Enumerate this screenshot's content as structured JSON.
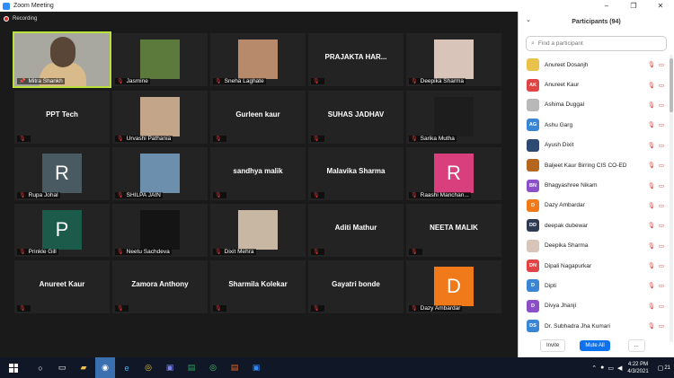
{
  "window": {
    "title": "Zoom Meeting",
    "controls": [
      "–",
      "❐",
      "✕"
    ]
  },
  "recording_label": "Recording",
  "tiles": [
    {
      "name": "Mitra Shankh",
      "kind": "video",
      "bg": "#a9a8a0",
      "active": true,
      "mic": "pin"
    },
    {
      "name": "Jasmine",
      "kind": "photo",
      "bg": "#5b7a3c"
    },
    {
      "name": "Sneha Laghate",
      "kind": "photo",
      "bg": "#b78a6b"
    },
    {
      "name": "PRAJAKTA HAR...",
      "kind": "text"
    },
    {
      "name": "Deepika Sharma",
      "kind": "photo",
      "bg": "#d8c4b8"
    },
    {
      "name": "PPT Tech",
      "kind": "text"
    },
    {
      "name": "Urvashi Pathania",
      "kind": "photo",
      "bg": "#c3a58a"
    },
    {
      "name": "Gurleen kaur",
      "kind": "text"
    },
    {
      "name": "SUHAS JADHAV",
      "kind": "text"
    },
    {
      "name": "Sarika Mutha",
      "kind": "photo",
      "bg": "#1d1d1d"
    },
    {
      "name": "Rupa Johal",
      "kind": "letter",
      "letter": "R",
      "bg": "#4a5a62"
    },
    {
      "name": "SHILPA JAIN",
      "kind": "photo",
      "bg": "#6d8fae"
    },
    {
      "name": "sandhya malik",
      "kind": "text"
    },
    {
      "name": "Malavika Sharma",
      "kind": "text"
    },
    {
      "name": "Raashi Manchan...",
      "kind": "letter",
      "letter": "R",
      "bg": "#d93f7c"
    },
    {
      "name": "Prinkle Gill",
      "kind": "letter",
      "letter": "P",
      "bg": "#1c5b4a"
    },
    {
      "name": "Neetu Sachdeva",
      "kind": "photo",
      "bg": "#141414"
    },
    {
      "name": "Dixit Mehra",
      "kind": "photo",
      "bg": "#c7b7a3"
    },
    {
      "name": "Aditi Mathur",
      "kind": "text"
    },
    {
      "name": "NEETA MALIK",
      "kind": "text"
    },
    {
      "name": "Anureet Kaur",
      "kind": "text"
    },
    {
      "name": "Zamora Anthony",
      "kind": "text"
    },
    {
      "name": "Sharmila Kolekar",
      "kind": "text"
    },
    {
      "name": "Gayatri bonde",
      "kind": "text"
    },
    {
      "name": "Dazy Ambardar",
      "kind": "letter",
      "letter": "D",
      "bg": "#f07a1a"
    }
  ],
  "participants_panel": {
    "title": "Participants (94)",
    "search_placeholder": "Find a participant",
    "people": [
      {
        "name": "Anureet Dosanjh",
        "initials": "",
        "color": "#e8c24a"
      },
      {
        "name": "Anureet Kaur",
        "initials": "AK",
        "color": "#e04444"
      },
      {
        "name": "Ashima Duggal",
        "initials": "",
        "color": "#b8b8b8"
      },
      {
        "name": "Ashu Garg",
        "initials": "AG",
        "color": "#3a86d4"
      },
      {
        "name": "Ayush Dixit",
        "initials": "",
        "color": "#2d4a73"
      },
      {
        "name": "Baljeet Kaur Birring CIS CO-ED",
        "initials": "",
        "color": "#b5651d"
      },
      {
        "name": "Bhagyashree Nikam",
        "initials": "BN",
        "color": "#8a4fc9"
      },
      {
        "name": "Dazy Ambardar",
        "initials": "D",
        "color": "#f07a1a"
      },
      {
        "name": "deepak dubewar",
        "initials": "DD",
        "color": "#2e3a52"
      },
      {
        "name": "Deepika Sharma",
        "initials": "",
        "color": "#d8c4b8"
      },
      {
        "name": "Dipali Nagapurkar",
        "initials": "DN",
        "color": "#e04444"
      },
      {
        "name": "Dipti",
        "initials": "D",
        "color": "#3a86d4"
      },
      {
        "name": "Divya Jhanji",
        "initials": "D",
        "color": "#8a4fc9"
      },
      {
        "name": "Dr. Subhadra Jha Kumari",
        "initials": "DS",
        "color": "#3a86d4"
      }
    ],
    "invite_label": "Invite",
    "mute_all_label": "Mute All",
    "more_label": "..."
  },
  "taskbar": {
    "time": "4:22 PM",
    "date": "4/3/2021",
    "notifications": "21"
  }
}
